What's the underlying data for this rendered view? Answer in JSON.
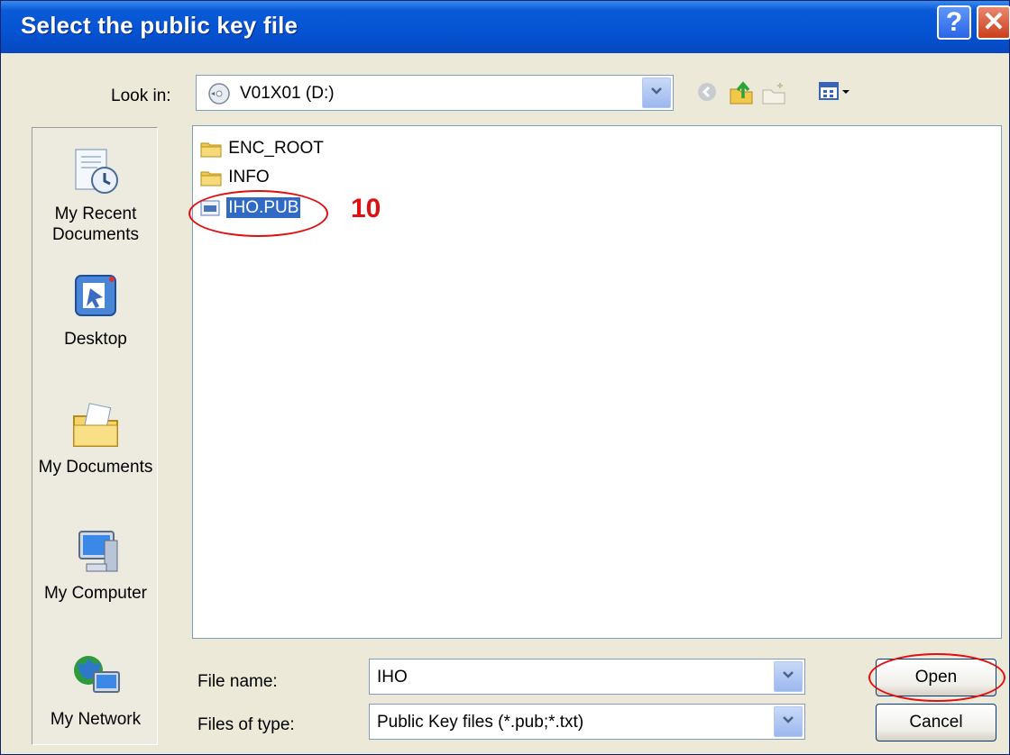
{
  "window": {
    "title": "Select the public key file",
    "help_label": "?",
    "close_label": "✕"
  },
  "lookin": {
    "label": "Look in:",
    "value": "V01X01 (D:)"
  },
  "toolbar": {
    "icons": [
      "back-icon",
      "up-folder-icon",
      "new-folder-icon",
      "views-menu-icon"
    ]
  },
  "places": [
    {
      "label": "My Recent\nDocuments",
      "icon": "recent-documents-icon"
    },
    {
      "label": "Desktop",
      "icon": "desktop-icon"
    },
    {
      "label": "My Documents",
      "icon": "my-documents-icon"
    },
    {
      "label": "My Computer",
      "icon": "my-computer-icon"
    },
    {
      "label": "My Network",
      "icon": "my-network-icon"
    }
  ],
  "files": [
    {
      "name": "ENC_ROOT",
      "type": "folder"
    },
    {
      "name": "INFO",
      "type": "folder"
    },
    {
      "name": "IHO.PUB",
      "type": "file",
      "selected": true
    }
  ],
  "annotation": {
    "step": "10",
    "color": "#E01010"
  },
  "filename": {
    "label": "File name:",
    "value": "IHO"
  },
  "filetype": {
    "label": "Files of type:",
    "value": "Public Key files (*.pub;*.txt)"
  },
  "buttons": {
    "open": "Open",
    "cancel": "Cancel"
  },
  "colors": {
    "titlebar": "#0553D2",
    "selection": "#316AC5",
    "face": "#ECE9D8"
  }
}
